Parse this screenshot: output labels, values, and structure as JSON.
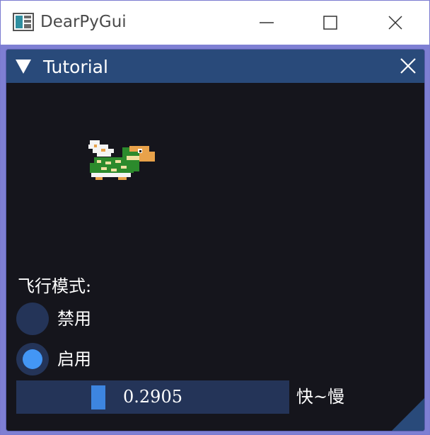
{
  "os_window": {
    "title": "DearPyGui",
    "icon": "app-icon",
    "controls": [
      "minimize-icon",
      "maximize-icon",
      "close-icon"
    ]
  },
  "panel": {
    "title": "Tutorial",
    "collapse_icon": "triangle-down-icon",
    "close_icon": "close-icon",
    "header_color": "#294a7a",
    "background_color": "#15151c"
  },
  "sprite": {
    "name": "flying-turtle-sprite"
  },
  "mode": {
    "label": "飞行模式:",
    "options": [
      {
        "label": "禁用",
        "selected": false
      },
      {
        "label": "启用",
        "selected": true
      }
    ],
    "accent": "#4396f5"
  },
  "slider": {
    "value": "0.2905",
    "fraction": 0.2905,
    "label": "快~慢",
    "grab_color": "#3d85e0"
  }
}
